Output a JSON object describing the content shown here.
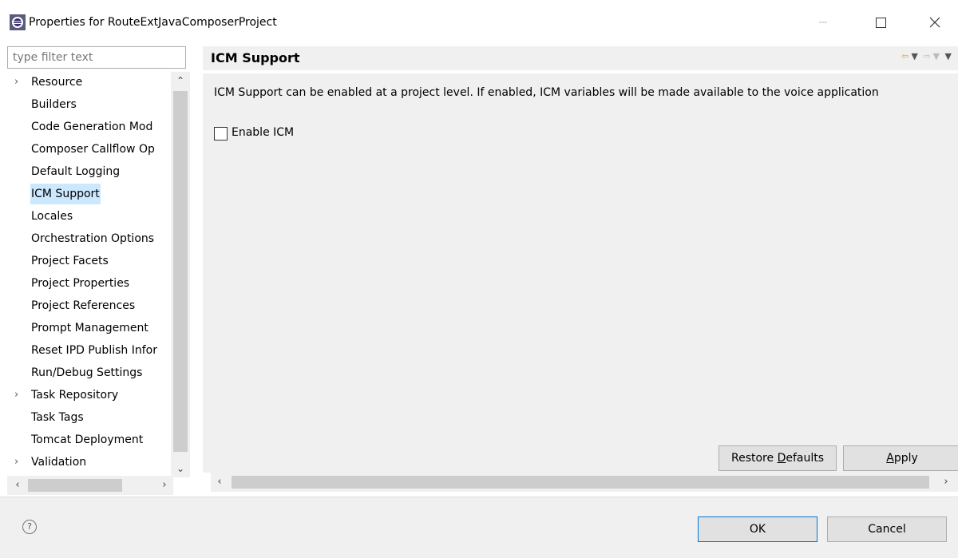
{
  "window": {
    "title": "Properties for RouteExtJavaComposerProject",
    "app_icon": "eclipse-icon",
    "controls": {
      "minimize": "minimize-icon",
      "maximize": "maximize-icon",
      "close": "close-icon"
    }
  },
  "filter": {
    "placeholder": "type filter text",
    "value": ""
  },
  "tree": {
    "items": [
      {
        "label": "Resource",
        "expandable": true
      },
      {
        "label": "Builders",
        "expandable": false
      },
      {
        "label": "Code Generation Mod",
        "expandable": false
      },
      {
        "label": "Composer Callflow Op",
        "expandable": false
      },
      {
        "label": "Default Logging",
        "expandable": false
      },
      {
        "label": "ICM Support",
        "expandable": false,
        "selected": true
      },
      {
        "label": "Locales",
        "expandable": false
      },
      {
        "label": "Orchestration Options",
        "expandable": false
      },
      {
        "label": "Project Facets",
        "expandable": false
      },
      {
        "label": "Project Properties",
        "expandable": false
      },
      {
        "label": "Project References",
        "expandable": false
      },
      {
        "label": "Prompt Management",
        "expandable": false
      },
      {
        "label": "Reset IPD Publish Infor",
        "expandable": false
      },
      {
        "label": "Run/Debug Settings",
        "expandable": false
      },
      {
        "label": "Task Repository",
        "expandable": true
      },
      {
        "label": "Task Tags",
        "expandable": false
      },
      {
        "label": "Tomcat Deployment",
        "expandable": false
      },
      {
        "label": "Validation",
        "expandable": true
      }
    ]
  },
  "page": {
    "title": "ICM Support",
    "description": "ICM Support can be enabled at a project level.  If enabled, ICM variables will be made available to the voice application",
    "enable_label": "Enable ICM",
    "enable_checked": false,
    "restore_defaults_label": "Restore ",
    "restore_defaults_underlined": "D",
    "restore_defaults_rest": "efaults",
    "apply_underlined": "A",
    "apply_rest": "pply"
  },
  "footer": {
    "help_icon": "help-icon",
    "ok_label": "OK",
    "cancel_label": "Cancel"
  },
  "colors": {
    "selection": "#cce8ff",
    "ok_border": "#0078d7",
    "dialog_bg": "#f0f0f0"
  }
}
